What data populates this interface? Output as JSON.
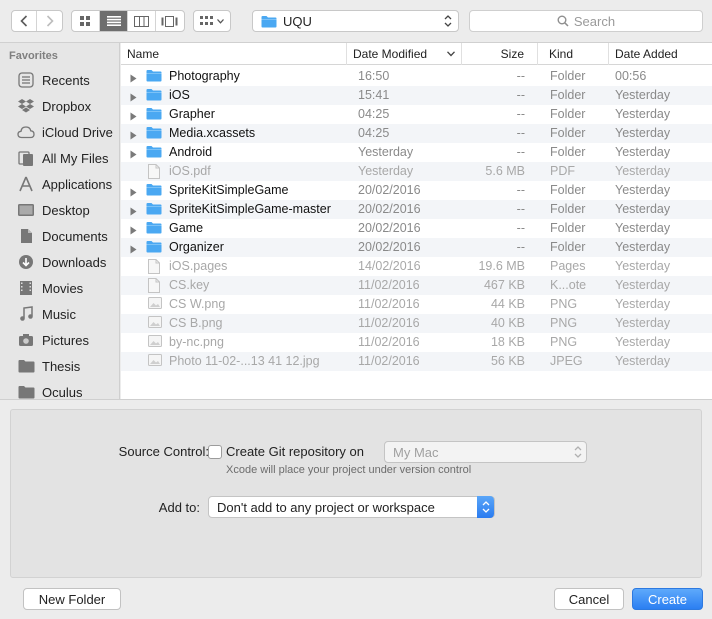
{
  "toolbar": {
    "path_label": "UQU",
    "search_placeholder": "Search"
  },
  "sidebar": {
    "header": "Favorites",
    "items": [
      {
        "label": "Recents",
        "icon": "clock-icon"
      },
      {
        "label": "Dropbox",
        "icon": "dropbox-icon"
      },
      {
        "label": "iCloud Drive",
        "icon": "cloud-icon"
      },
      {
        "label": "All My Files",
        "icon": "files-icon"
      },
      {
        "label": "Applications",
        "icon": "applications-icon"
      },
      {
        "label": "Desktop",
        "icon": "desktop-icon"
      },
      {
        "label": "Documents",
        "icon": "documents-icon"
      },
      {
        "label": "Downloads",
        "icon": "download-icon"
      },
      {
        "label": "Movies",
        "icon": "movies-icon"
      },
      {
        "label": "Music",
        "icon": "music-icon"
      },
      {
        "label": "Pictures",
        "icon": "camera-icon"
      },
      {
        "label": "Thesis",
        "icon": "folder-icon"
      },
      {
        "label": "Oculus",
        "icon": "folder-icon"
      }
    ]
  },
  "columns": {
    "name": "Name",
    "date_modified": "Date Modified",
    "size": "Size",
    "kind": "Kind",
    "date_added": "Date Added"
  },
  "files": [
    {
      "name": "Photography",
      "modified": "16:50",
      "size": "--",
      "kind": "Folder",
      "added": "00:56",
      "type": "folder",
      "enabled": true
    },
    {
      "name": "iOS",
      "modified": "15:41",
      "size": "--",
      "kind": "Folder",
      "added": "Yesterday",
      "type": "folder",
      "enabled": true
    },
    {
      "name": "Grapher",
      "modified": "04:25",
      "size": "--",
      "kind": "Folder",
      "added": "Yesterday",
      "type": "folder",
      "enabled": true
    },
    {
      "name": "Media.xcassets",
      "modified": "04:25",
      "size": "--",
      "kind": "Folder",
      "added": "Yesterday",
      "type": "folder",
      "enabled": true
    },
    {
      "name": "Android",
      "modified": "Yesterday",
      "size": "--",
      "kind": "Folder",
      "added": "Yesterday",
      "type": "folder",
      "enabled": true
    },
    {
      "name": "iOS.pdf",
      "modified": "Yesterday",
      "size": "5.6 MB",
      "kind": "PDF",
      "added": "Yesterday",
      "type": "file",
      "enabled": false
    },
    {
      "name": "SpriteKitSimpleGame",
      "modified": "20/02/2016",
      "size": "--",
      "kind": "Folder",
      "added": "Yesterday",
      "type": "folder",
      "enabled": true
    },
    {
      "name": "SpriteKitSimpleGame-master",
      "modified": "20/02/2016",
      "size": "--",
      "kind": "Folder",
      "added": "Yesterday",
      "type": "folder",
      "enabled": true
    },
    {
      "name": "Game",
      "modified": "20/02/2016",
      "size": "--",
      "kind": "Folder",
      "added": "Yesterday",
      "type": "folder",
      "enabled": true
    },
    {
      "name": "Organizer",
      "modified": "20/02/2016",
      "size": "--",
      "kind": "Folder",
      "added": "Yesterday",
      "type": "folder",
      "enabled": true
    },
    {
      "name": "iOS.pages",
      "modified": "14/02/2016",
      "size": "19.6 MB",
      "kind": "Pages",
      "added": "Yesterday",
      "type": "file",
      "enabled": false
    },
    {
      "name": "CS.key",
      "modified": "11/02/2016",
      "size": "467 KB",
      "kind": "K...ote",
      "added": "Yesterday",
      "type": "file",
      "enabled": false
    },
    {
      "name": "CS W.png",
      "modified": "11/02/2016",
      "size": "44 KB",
      "kind": "PNG",
      "added": "Yesterday",
      "type": "image",
      "enabled": false
    },
    {
      "name": "CS B.png",
      "modified": "11/02/2016",
      "size": "40 KB",
      "kind": "PNG",
      "added": "Yesterday",
      "type": "image",
      "enabled": false
    },
    {
      "name": "by-nc.png",
      "modified": "11/02/2016",
      "size": "18 KB",
      "kind": "PNG",
      "added": "Yesterday",
      "type": "image",
      "enabled": false
    },
    {
      "name": "Photo 11-02-...13 41 12.jpg",
      "modified": "11/02/2016",
      "size": "56 KB",
      "kind": "JPEG",
      "added": "Yesterday",
      "type": "image",
      "enabled": false
    }
  ],
  "options": {
    "source_control_label": "Source Control:",
    "create_git_label": "Create Git repository on",
    "git_location": "My Mac",
    "git_note": "Xcode will place your project under version control",
    "add_to_label": "Add to:",
    "add_to_value": "Don't add to any project or workspace"
  },
  "buttons": {
    "new_folder": "New Folder",
    "cancel": "Cancel",
    "create": "Create"
  },
  "colors": {
    "folder": "#4aa8f2",
    "accent": "#2b7ff2"
  }
}
